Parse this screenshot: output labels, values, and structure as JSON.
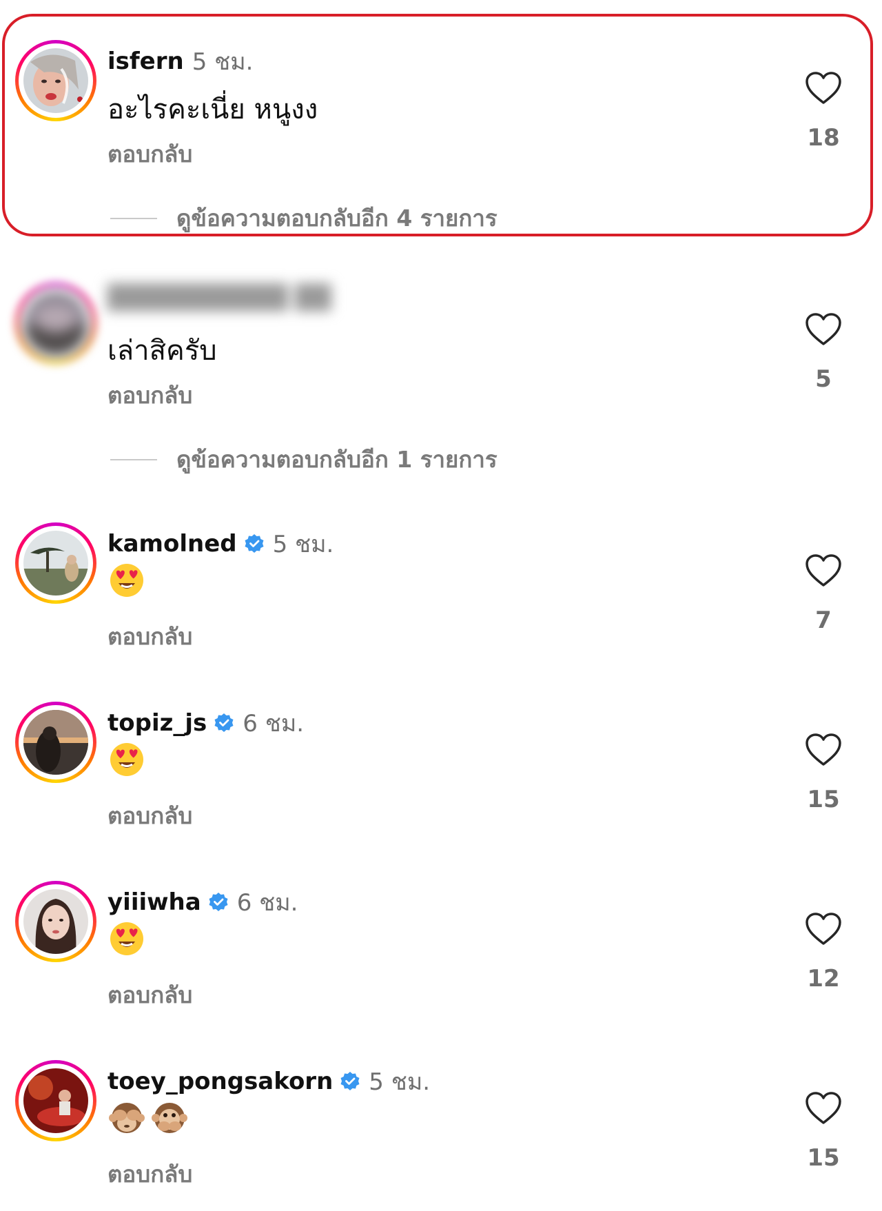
{
  "comments": [
    {
      "username": "isfern",
      "time": "5 ชม.",
      "verified": false,
      "text": "อะไรคะเนี่ย หนูงง",
      "reply_label": "ตอบกลับ",
      "likes": "18",
      "view_replies": "ดูข้อความตอบกลับอีก 4 รายการ",
      "highlighted": true
    },
    {
      "username": "",
      "time": "",
      "verified": false,
      "text": "เล่าสิครับ",
      "reply_label": "ตอบกลับ",
      "likes": "5",
      "view_replies": "ดูข้อความตอบกลับอีก 1 รายการ",
      "blurred": true
    },
    {
      "username": "kamolned",
      "time": "5 ชม.",
      "verified": true,
      "emojis": [
        "heart-eyes-emoji"
      ],
      "reply_label": "ตอบกลับ",
      "likes": "7"
    },
    {
      "username": "topiz_js",
      "time": "6 ชม.",
      "verified": true,
      "emojis": [
        "heart-eyes-emoji"
      ],
      "reply_label": "ตอบกลับ",
      "likes": "15"
    },
    {
      "username": "yiiiwha",
      "time": "6 ชม.",
      "verified": true,
      "emojis": [
        "heart-eyes-emoji"
      ],
      "reply_label": "ตอบกลับ",
      "likes": "12"
    },
    {
      "username": "toey_pongsakorn",
      "time": "5 ชม.",
      "verified": true,
      "emojis": [
        "see-no-evil-monkey-emoji",
        "speak-no-evil-monkey-emoji"
      ],
      "reply_label": "ตอบกลับ",
      "likes": "15"
    }
  ],
  "colors": {
    "highlight_border": "#d81e28",
    "verified_badge": "#3897f0",
    "secondary_text": "#7a7a7a"
  },
  "icons": {
    "like": "heart-outline-icon",
    "verified": "verified-badge-icon"
  }
}
